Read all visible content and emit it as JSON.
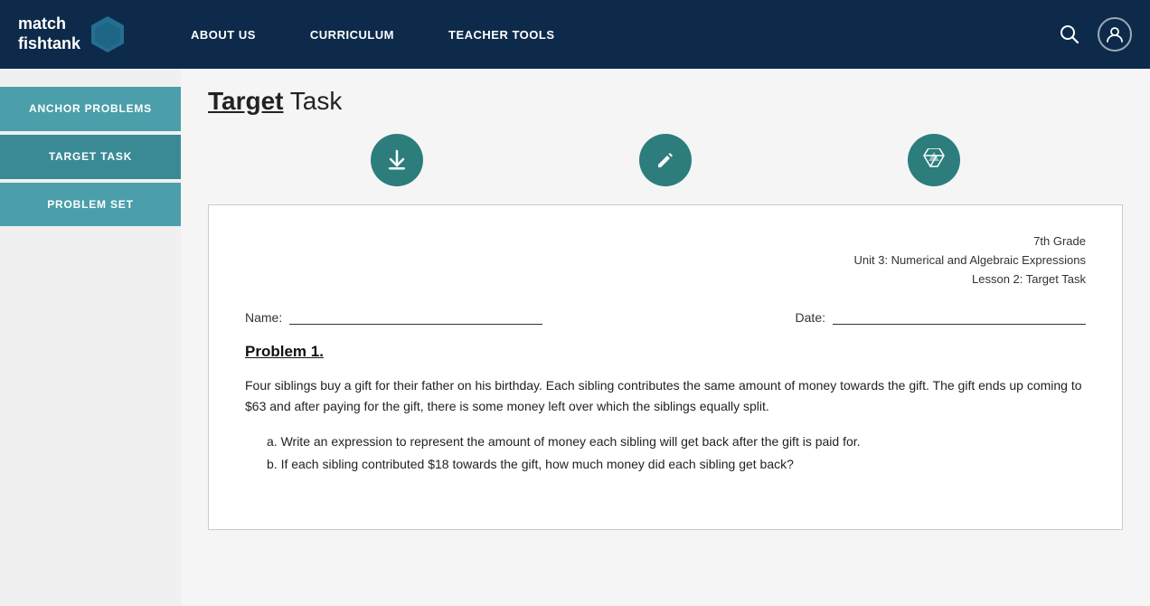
{
  "header": {
    "logo_line1": "match",
    "logo_line2": "fishtank",
    "nav": [
      {
        "label": "ABOUT US",
        "id": "about-us"
      },
      {
        "label": "CURRICULUM",
        "id": "curriculum"
      },
      {
        "label": "TEACHER TOOLS",
        "id": "teacher-tools"
      }
    ]
  },
  "sidebar": {
    "items": [
      {
        "label": "ANCHOR\nPROBLEMS",
        "id": "anchor-problems"
      },
      {
        "label": "TARGET TASK",
        "id": "target-task",
        "active": true
      },
      {
        "label": "PROBLEM SET",
        "id": "problem-set"
      }
    ]
  },
  "main": {
    "page_title_bold": "Target",
    "page_title_rest": " Task",
    "action_buttons": [
      {
        "icon": "⬇",
        "name": "download-button"
      },
      {
        "icon": "✏",
        "name": "edit-button"
      },
      {
        "icon": "☁",
        "name": "drive-button"
      }
    ],
    "document": {
      "grade": "7th Grade",
      "unit": "Unit 3: Numerical and Algebraic Expressions",
      "lesson": "Lesson 2: Target Task",
      "name_label": "Name:",
      "date_label": "Date:",
      "problem_title": "Problem 1.",
      "problem_intro": "Four siblings buy a gift for their father on his birthday. Each sibling contributes the same amount of money towards the gift. The gift ends up coming to $63 and after paying for the gift, there is some money left over which the siblings equally split.",
      "parts": [
        "a. Write an expression to represent the amount of money each sibling will get back after the gift is paid for.",
        "b. If each sibling contributed $18 towards the gift, how much money did each sibling get back?"
      ]
    }
  }
}
